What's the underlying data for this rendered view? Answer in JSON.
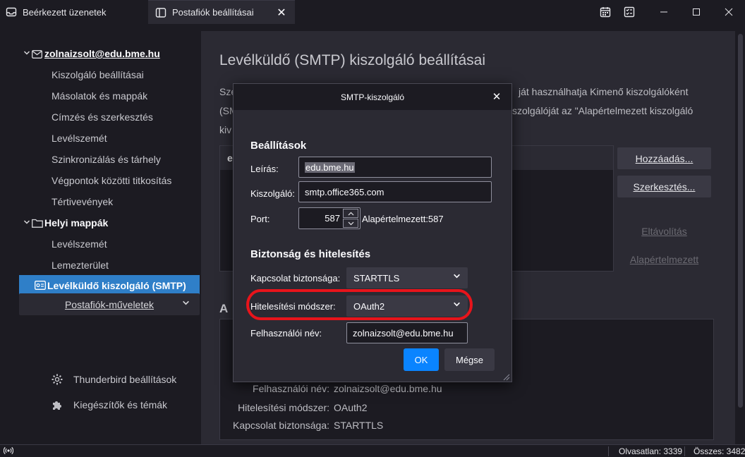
{
  "tabs": [
    {
      "label": "Beérkezett üzenetek",
      "icon": "inbox-icon"
    },
    {
      "label": "Postafiók beállításai",
      "icon": "settings-tab-icon",
      "close": "✕"
    }
  ],
  "window": {
    "minimize": "—",
    "maximize": "☐",
    "close": "✕"
  },
  "sidebar": {
    "account": "zolnaizsolt@edu.bme.hu",
    "account_items": [
      "Kiszolgáló beállításai",
      "Másolatok és mappák",
      "Címzés és szerkesztés",
      "Levélszemét",
      "Szinkronizálás és tárhely",
      "Végpontok közötti titkosítás",
      "Tértivevények"
    ],
    "local_folders": "Helyi mappák",
    "local_items": [
      "Levélszemét",
      "Lemezterület"
    ],
    "smtp_item": "Levélküldő kiszolgáló (SMTP)",
    "account_actions": "Postafiók-műveletek",
    "footer": [
      {
        "label": "Thunderbird beállítások",
        "icon": "gear-icon"
      },
      {
        "label": "Kiegészítők és témák",
        "icon": "puzzle-icon"
      }
    ]
  },
  "main": {
    "title": "Levélküldő (SMTP) kiszolgáló beállításai",
    "desc_lines": [
      "Sze",
      "(SM",
      "kiv"
    ],
    "desc_right_lines": [
      "ját használhatja Kimenő kiszolgálóként",
      "szolgálóját az \"Alapértelmezett kiszolgáló"
    ],
    "list_first": "e",
    "buttons": {
      "add": "Hozzáadás...",
      "edit": "Szerkesztés...",
      "remove": "Eltávolítás",
      "default": "Alapértelmezett"
    },
    "details_heading": "A",
    "details": [
      {
        "key": "Felhasználói név:",
        "value": "zolnaizsolt@edu.bme.hu"
      },
      {
        "key": "Hitelesítési módszer:",
        "value": "OAuth2"
      },
      {
        "key": "Kapcsolat biztonsága:",
        "value": "STARTTLS"
      }
    ]
  },
  "dialog": {
    "title": "SMTP-kiszolgáló",
    "close": "✕",
    "settings_heading": "Beállítások",
    "description_label": "Leírás:",
    "description_value": "edu.bme.hu",
    "server_label": "Kiszolgáló:",
    "server_value": "smtp.office365.com",
    "port_label": "Port:",
    "port_value": "587",
    "port_default": "Alapértelmezett:587",
    "security_heading": "Biztonság és hitelesítés",
    "conn_security_label": "Kapcsolat biztonsága:",
    "conn_security_value": "STARTTLS",
    "auth_method_label": "Hitelesítési módszer:",
    "auth_method_value": "OAuth2",
    "username_label": "Felhasználói név:",
    "username_value": "zolnaizsolt@edu.bme.hu",
    "ok": "OK",
    "cancel": "Mégse"
  },
  "status": {
    "unread": "Olvasatlan: 3339",
    "total": "Összes: 3482"
  },
  "colors": {
    "accent": "#0a84ff",
    "selection": "#2f7fc8",
    "highlight_ring": "#e8141b"
  }
}
